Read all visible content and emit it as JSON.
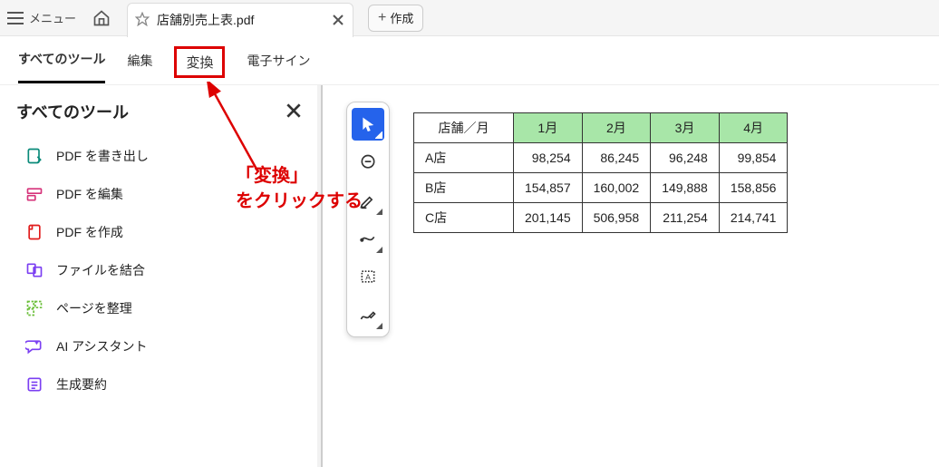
{
  "appbar": {
    "menu_label": "メニュー",
    "tab_title": "店舗別売上表.pdf",
    "create_label": "作成"
  },
  "subnav": {
    "all_tools": "すべてのツール",
    "edit": "編集",
    "convert": "変換",
    "esign": "電子サイン"
  },
  "sidebar": {
    "title": "すべてのツール",
    "items": [
      {
        "label": "PDF を書き出し"
      },
      {
        "label": "PDF を編集"
      },
      {
        "label": "PDF を作成"
      },
      {
        "label": "ファイルを結合"
      },
      {
        "label": "ページを整理"
      },
      {
        "label": "AI アシスタント"
      },
      {
        "label": "生成要約"
      }
    ]
  },
  "annotation": {
    "line1": "「変換」",
    "line2": "をクリックする"
  },
  "chart_data": {
    "type": "table",
    "corner_header": "店舗／月",
    "columns": [
      "1月",
      "2月",
      "3月",
      "4月"
    ],
    "rows": [
      {
        "name": "A店",
        "values": [
          "98,254",
          "86,245",
          "96,248",
          "99,854"
        ]
      },
      {
        "name": "B店",
        "values": [
          "154,857",
          "160,002",
          "149,888",
          "158,856"
        ]
      },
      {
        "name": "C店",
        "values": [
          "201,145",
          "506,958",
          "211,254",
          "214,741"
        ]
      }
    ]
  }
}
